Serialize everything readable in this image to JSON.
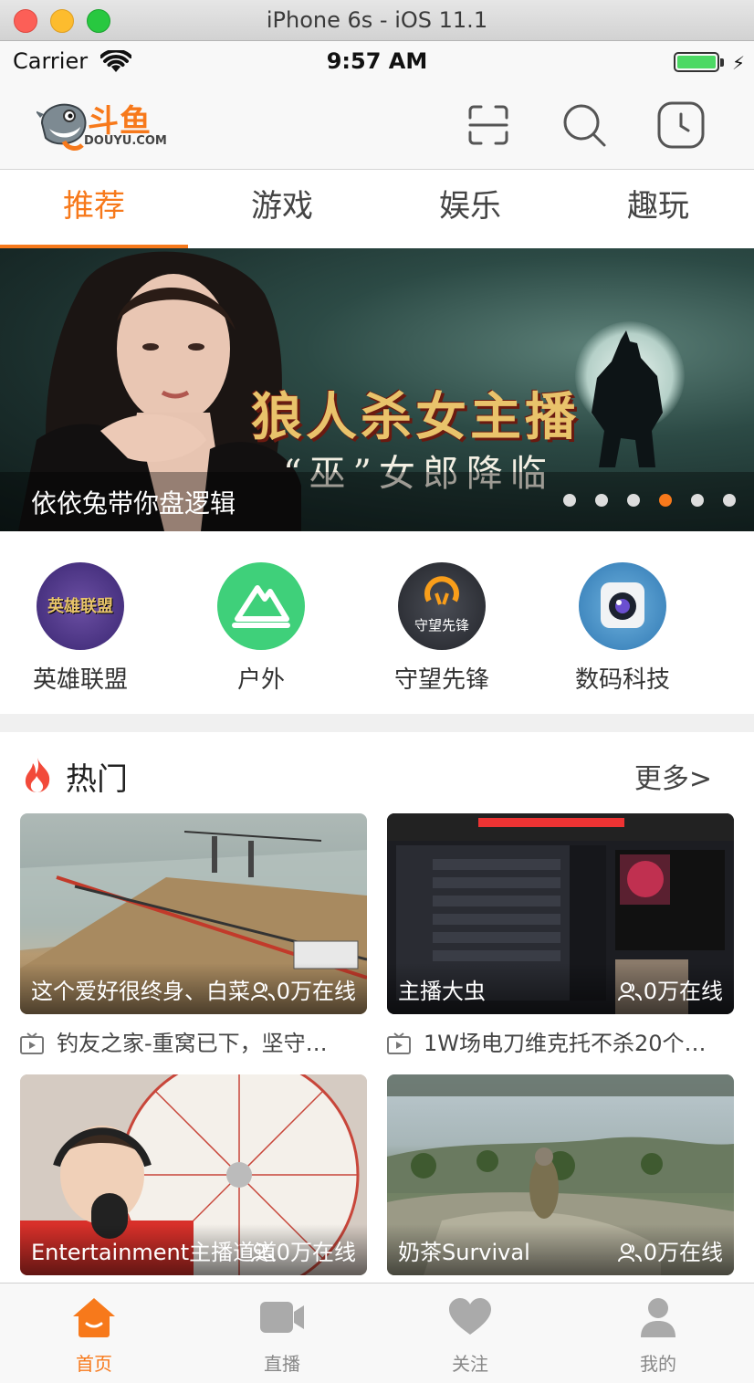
{
  "window": {
    "title": "iPhone 6s - iOS 11.1"
  },
  "status_bar": {
    "carrier": "Carrier",
    "time": "9:57 AM"
  },
  "header": {
    "logo_cn": "斗鱼",
    "logo_en": "DOUYU.COM"
  },
  "tabs": [
    {
      "label": "推荐",
      "active": true
    },
    {
      "label": "游戏",
      "active": false
    },
    {
      "label": "娱乐",
      "active": false
    },
    {
      "label": "趣玩",
      "active": false
    }
  ],
  "banner": {
    "headline": "狼人杀女主播",
    "subline": "“巫”女郎降临",
    "caption": "依依兔带你盘逻辑",
    "dots_count": 6,
    "active_dot": 3
  },
  "categories": [
    {
      "label": "英雄联盟",
      "icon": "lol-icon",
      "icon_text": "英雄联盟"
    },
    {
      "label": "户外",
      "icon": "outdoor-icon"
    },
    {
      "label": "守望先锋",
      "icon": "overwatch-icon",
      "icon_text": "守望先锋"
    },
    {
      "label": "数码科技",
      "icon": "camera-icon"
    }
  ],
  "hot": {
    "title": "热门",
    "more": "更多>",
    "cards": [
      {
        "anchor": "这个爱好很终身、白菜",
        "viewers": "0万在线",
        "room": "钓友之家-重窝已下，坚守…",
        "thumb": "fishing"
      },
      {
        "anchor": "主播大虫",
        "viewers": "0万在线",
        "room": "1W场电刀维克托不杀20个…",
        "thumb": "screen"
      },
      {
        "anchor": "Entertainment主播道道",
        "viewers": "0万在线",
        "room": "",
        "thumb": "wheel"
      },
      {
        "anchor": "奶茶Survival",
        "viewers": "0万在线",
        "room": "",
        "thumb": "landscape"
      }
    ]
  },
  "tabbar": [
    {
      "label": "首页",
      "icon": "home-icon",
      "active": true
    },
    {
      "label": "直播",
      "icon": "video-icon",
      "active": false
    },
    {
      "label": "关注",
      "icon": "heart-icon",
      "active": false
    },
    {
      "label": "我的",
      "icon": "user-icon",
      "active": false
    }
  ],
  "colors": {
    "accent": "#f7791b",
    "inactive": "#888888"
  }
}
